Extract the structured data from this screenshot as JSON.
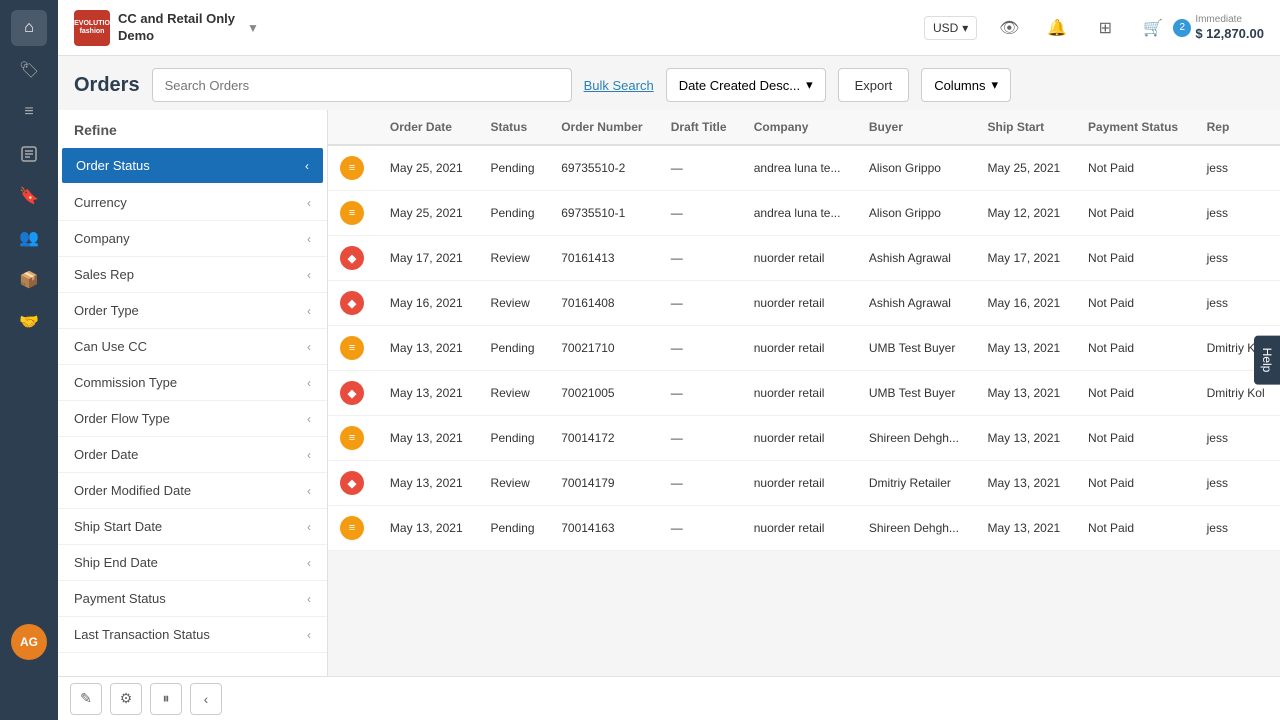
{
  "header": {
    "brand_logo_text": "REVOLUTION fashion",
    "brand_name_line1": "CC and Retail Only",
    "brand_name_line2": "Demo",
    "currency": "USD",
    "cart_badge": "2",
    "cart_amount": "$ 12,870.00",
    "cart_label": "Immediate"
  },
  "page": {
    "title": "Orders",
    "search_placeholder": "Search Orders",
    "bulk_search": "Bulk Search",
    "sort_label": "Date Created Desc...",
    "export_label": "Export",
    "columns_label": "Columns"
  },
  "refine": {
    "title": "Refine",
    "items": [
      {
        "label": "Order Status",
        "active": true
      },
      {
        "label": "Currency",
        "active": false
      },
      {
        "label": "Company",
        "active": false
      },
      {
        "label": "Sales Rep",
        "active": false
      },
      {
        "label": "Order Type",
        "active": false
      },
      {
        "label": "Can Use CC",
        "active": false
      },
      {
        "label": "Commission Type",
        "active": false
      },
      {
        "label": "Order Flow Type",
        "active": false
      },
      {
        "label": "Order Date",
        "active": false
      },
      {
        "label": "Order Modified Date",
        "active": false
      },
      {
        "label": "Ship Start Date",
        "active": false
      },
      {
        "label": "Ship End Date",
        "active": false
      },
      {
        "label": "Payment Status",
        "active": false
      },
      {
        "label": "Last Transaction Status",
        "active": false
      }
    ]
  },
  "table": {
    "columns": [
      "",
      "Order Date",
      "Status",
      "Order Number",
      "Draft Title",
      "Company",
      "Buyer",
      "Ship Start",
      "Payment Status",
      "Rep"
    ],
    "rows": [
      {
        "icon_type": "yellow",
        "icon_char": "≡",
        "order_date": "May 25, 2021",
        "status": "Pending",
        "order_number": "69735510-2",
        "draft_title": "—",
        "company": "andrea luna te...",
        "buyer": "Alison Grippo",
        "ship_start": "May 25, 2021",
        "payment_status": "Not Paid",
        "rep": "jess"
      },
      {
        "icon_type": "yellow",
        "icon_char": "≡",
        "order_date": "May 25, 2021",
        "status": "Pending",
        "order_number": "69735510-1",
        "draft_title": "—",
        "company": "andrea luna te...",
        "buyer": "Alison Grippo",
        "ship_start": "May 12, 2021",
        "payment_status": "Not Paid",
        "rep": "jess"
      },
      {
        "icon_type": "pink",
        "icon_char": "♦",
        "order_date": "May 17, 2021",
        "status": "Review",
        "order_number": "70161413",
        "draft_title": "—",
        "company": "nuorder retail",
        "buyer": "Ashish Agrawal",
        "ship_start": "May 17, 2021",
        "payment_status": "Not Paid",
        "rep": "jess"
      },
      {
        "icon_type": "pink",
        "icon_char": "♦",
        "order_date": "May 16, 2021",
        "status": "Review",
        "order_number": "70161408",
        "draft_title": "—",
        "company": "nuorder retail",
        "buyer": "Ashish Agrawal",
        "ship_start": "May 16, 2021",
        "payment_status": "Not Paid",
        "rep": "jess"
      },
      {
        "icon_type": "yellow",
        "icon_char": "≡",
        "order_date": "May 13, 2021",
        "status": "Pending",
        "order_number": "70021710",
        "draft_title": "—",
        "company": "nuorder retail",
        "buyer": "UMB Test Buyer",
        "ship_start": "May 13, 2021",
        "payment_status": "Not Paid",
        "rep": "Dmitriy Kol"
      },
      {
        "icon_type": "pink",
        "icon_char": "♦",
        "order_date": "May 13, 2021",
        "status": "Review",
        "order_number": "70021005",
        "draft_title": "—",
        "company": "nuorder retail",
        "buyer": "UMB Test Buyer",
        "ship_start": "May 13, 2021",
        "payment_status": "Not Paid",
        "rep": "Dmitriy Kol"
      },
      {
        "icon_type": "yellow",
        "icon_char": "≡",
        "order_date": "May 13, 2021",
        "status": "Pending",
        "order_number": "70014172",
        "draft_title": "—",
        "company": "nuorder retail",
        "buyer": "Shireen Dehgh...",
        "ship_start": "May 13, 2021",
        "payment_status": "Not Paid",
        "rep": "jess"
      },
      {
        "icon_type": "pink",
        "icon_char": "♦",
        "order_date": "May 13, 2021",
        "status": "Review",
        "order_number": "70014179",
        "draft_title": "—",
        "company": "nuorder retail",
        "buyer": "Dmitriy Retailer",
        "ship_start": "May 13, 2021",
        "payment_status": "Not Paid",
        "rep": "jess"
      },
      {
        "icon_type": "yellow",
        "icon_char": "≡",
        "order_date": "May 13, 2021",
        "status": "Pending",
        "order_number": "70014163",
        "draft_title": "—",
        "company": "nuorder retail",
        "buyer": "Shireen Dehgh...",
        "ship_start": "May 13, 2021",
        "payment_status": "Not Paid",
        "rep": "jess"
      }
    ]
  },
  "sidebar": {
    "icons": [
      {
        "name": "home-icon",
        "symbol": "⌂"
      },
      {
        "name": "tag-icon",
        "symbol": "🏷"
      },
      {
        "name": "list-icon",
        "symbol": "☰"
      },
      {
        "name": "orders-icon",
        "symbol": "📋"
      },
      {
        "name": "bookmark-icon",
        "symbol": "🔖"
      },
      {
        "name": "users-icon",
        "symbol": "👥"
      },
      {
        "name": "products-icon",
        "symbol": "📦"
      },
      {
        "name": "partners-icon",
        "symbol": "🤝"
      }
    ],
    "avatar_initials": "AG"
  },
  "toolbar": {
    "edit_icon": "✎",
    "adjust_icon": "⚙",
    "pause_icon": "⏸",
    "arrow_icon": "‹"
  },
  "help": {
    "label": "Help"
  }
}
